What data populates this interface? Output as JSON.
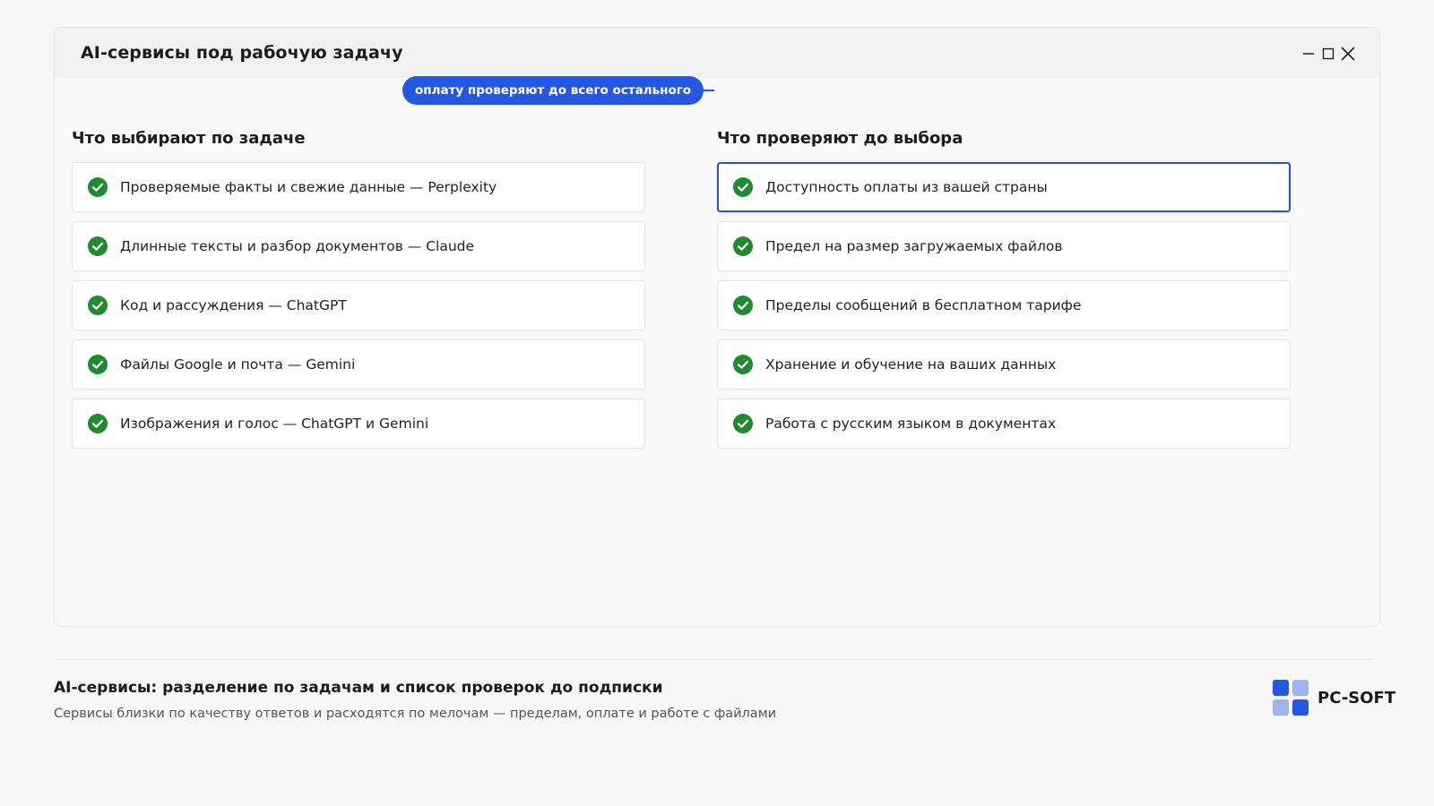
{
  "window": {
    "title": "AI-сервисы под рабочую задачу",
    "controls": {
      "minimize": "minimize-icon",
      "maximize": "maximize-icon",
      "close": "close-icon"
    }
  },
  "left": {
    "heading": "Что выбирают по задаче",
    "items": [
      {
        "label": "Проверяемые факты и свежие данные — Perplexity"
      },
      {
        "label": "Длинные тексты и разбор документов — Claude"
      },
      {
        "label": "Код и рассуждения — ChatGPT"
      },
      {
        "label": "Файлы Google и почта — Gemini"
      },
      {
        "label": "Изображения и голос — ChatGPT и Gemini"
      }
    ]
  },
  "right": {
    "heading": "Что проверяют до выбора",
    "items": [
      {
        "label": "Доступность оплаты из вашей страны",
        "selected": true
      },
      {
        "label": "Предел на размер загружаемых файлов"
      },
      {
        "label": "Пределы сообщений в бесплатном тарифе"
      },
      {
        "label": "Хранение и обучение на ваших данных"
      },
      {
        "label": "Работа с русским языком в документах"
      }
    ]
  },
  "callout": {
    "text": "оплату проверяют до всего остального"
  },
  "footer": {
    "title": "AI-сервисы: разделение по задачам и список проверок до подписки",
    "subtitle": "Сервисы близки по качеству ответов и расходятся по мелочам — пределам, оплате и работе с файлами",
    "brand": "PC-SOFT"
  },
  "colors": {
    "accent": "#2458e0",
    "check": "#1f8a2e",
    "logo": [
      "#2458e0",
      "#9fb4ec",
      "#9fb4ec",
      "#2458e0"
    ]
  }
}
